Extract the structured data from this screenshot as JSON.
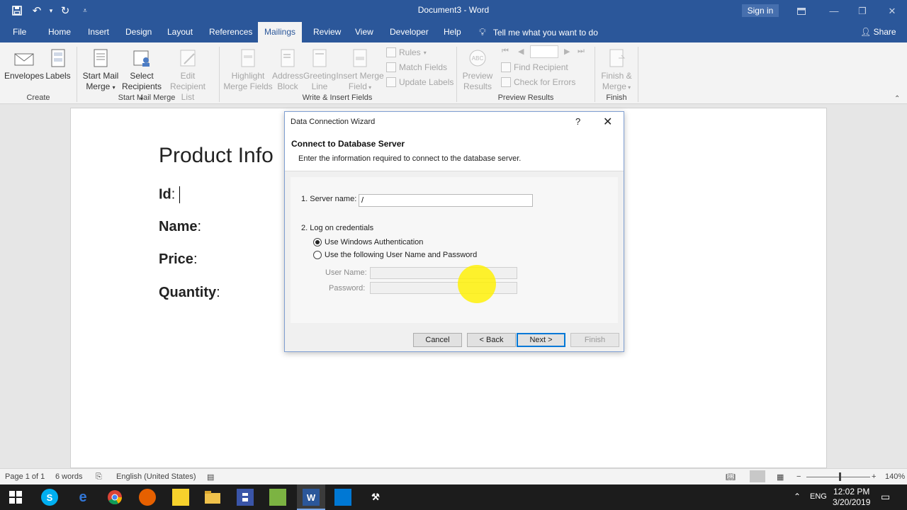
{
  "window": {
    "title": "Document3  -  Word",
    "signin_label": "Sign in"
  },
  "quick_access": [
    "save-icon",
    "undo-icon",
    "redo-icon",
    "customize-icon"
  ],
  "tabs": [
    {
      "label": "File"
    },
    {
      "label": "Home"
    },
    {
      "label": "Insert"
    },
    {
      "label": "Design"
    },
    {
      "label": "Layout"
    },
    {
      "label": "References"
    },
    {
      "label": "Mailings"
    },
    {
      "label": "Review"
    },
    {
      "label": "View"
    },
    {
      "label": "Developer"
    },
    {
      "label": "Help"
    }
  ],
  "active_tab": "Mailings",
  "tell_me": "Tell me what you want to do",
  "share_label": "Share",
  "ribbon": {
    "create": {
      "envelopes": "Envelopes",
      "labels": "Labels",
      "group": "Create"
    },
    "start_mail_merge": {
      "start_l1": "Start Mail",
      "start_l2": "Merge",
      "select_l1": "Select",
      "select_l2": "Recipients",
      "edit_l1": "Edit",
      "edit_l2": "Recipient List",
      "group": "Start Mail Merge"
    },
    "write_insert": {
      "highlight_l1": "Highlight",
      "highlight_l2": "Merge Fields",
      "address_l1": "Address",
      "address_l2": "Block",
      "greeting_l1": "Greeting",
      "greeting_l2": "Line",
      "insert_l1": "Insert Merge",
      "insert_l2": "Field",
      "rules": "Rules",
      "match": "Match Fields",
      "update": "Update Labels",
      "group": "Write & Insert Fields"
    },
    "preview": {
      "preview_l1": "Preview",
      "preview_l2": "Results",
      "find": "Find Recipient",
      "check": "Check for Errors",
      "group": "Preview Results"
    },
    "finish": {
      "finish_l1": "Finish &",
      "finish_l2": "Merge",
      "group": "Finish"
    }
  },
  "document": {
    "heading": "Product Info",
    "fields": [
      {
        "label": "Id",
        "sep": ":"
      },
      {
        "label": "Name",
        "sep": ":"
      },
      {
        "label": "Price",
        "sep": ":"
      },
      {
        "label": "Quantity",
        "sep": ":"
      }
    ]
  },
  "dialog": {
    "title": "Data Connection Wizard",
    "help": "?",
    "close": "✕",
    "heading": "Connect to Database Server",
    "subheading": "Enter the information required to connect to the database server.",
    "server_label": "1. Server name:",
    "server_value": "/",
    "logon_label": "2. Log on credentials",
    "radio_windows": "Use Windows Authentication",
    "radio_userpass": "Use the following User Name and Password",
    "selected_auth": "windows",
    "username_label": "User Name:",
    "password_label": "Password:",
    "btn_cancel": "Cancel",
    "btn_back": "< Back",
    "btn_next": "Next >",
    "btn_finish": "Finish"
  },
  "statusbar": {
    "page": "Page 1 of 1",
    "words": "6 words",
    "language": "English (United States)",
    "zoom": "140%"
  },
  "taskbar": {
    "time": "12:02 PM",
    "date": "3/20/2019",
    "lang": "ENG",
    "apps": [
      "windows-start-icon",
      "skype-icon",
      "edge-icon",
      "chrome-icon",
      "firefox-icon",
      "sticky-notes-icon",
      "file-explorer-icon",
      "save-app-icon",
      "notepad-plus-icon",
      "word-icon",
      "outlook-icon",
      "tools-icon"
    ]
  }
}
